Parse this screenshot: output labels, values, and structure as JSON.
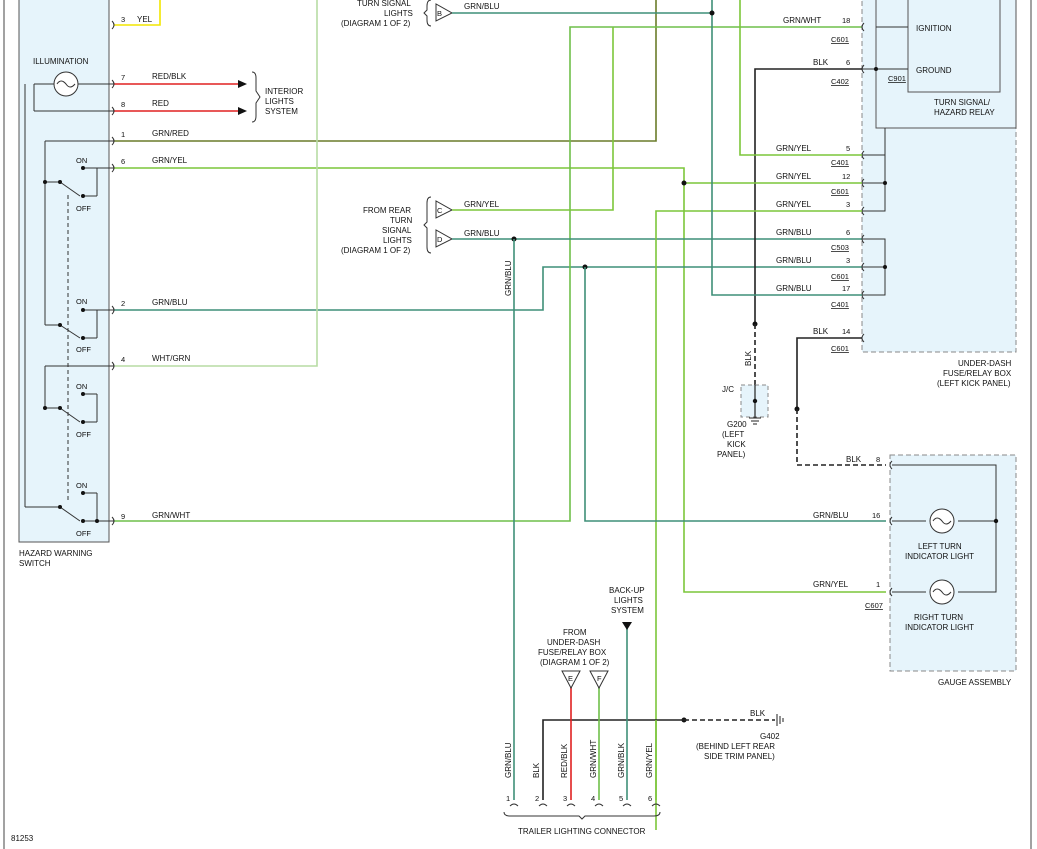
{
  "colors": {
    "grn_blu": "#3f8f78",
    "grn_yel": "#7cc63a",
    "grn_wht": "#6fbf4a",
    "grn_red": "#6a7c2a",
    "red": "#e02020",
    "yel": "#f2e600",
    "wht_grn": "#b7dca4",
    "blk": "#222222",
    "box_fill": "#e6f4fb",
    "box_stroke": "#666666"
  },
  "hazard_switch": {
    "title_line1": "HAZARD WARNING",
    "title_line2": "SWITCH",
    "illumination": "ILLUMINATION",
    "pins": [
      {
        "pin": "3",
        "wire": "YEL"
      },
      {
        "pin": "7",
        "wire": "RED/BLK"
      },
      {
        "pin": "8",
        "wire": "RED"
      },
      {
        "pin": "1",
        "wire": "GRN/RED"
      },
      {
        "pin": "6",
        "wire": "GRN/YEL"
      },
      {
        "pin": "2",
        "wire": "GRN/BLU"
      },
      {
        "pin": "4",
        "wire": "WHT/GRN"
      },
      {
        "pin": "9",
        "wire": "GRN/WHT"
      }
    ],
    "switch_on": "ON",
    "switch_off": "OFF"
  },
  "interior_lights": [
    "INTERIOR",
    "LIGHTS",
    "SYSTEM"
  ],
  "front_turn": {
    "lines": [
      "TURN SIGNAL",
      "LIGHTS",
      "(DIAGRAM 1 OF 2)"
    ],
    "conn_b": "B",
    "wire_b": "GRN/BLU"
  },
  "rear_turn": {
    "lines": [
      "FROM REAR",
      "TURN",
      "SIGNAL",
      "LIGHTS",
      "(DIAGRAM 1 OF 2)"
    ],
    "conn_c": "C",
    "conn_d": "D",
    "wire_c": "GRN/YEL",
    "wire_d": "GRN/BLU"
  },
  "relay": {
    "ignition": "IGNITION",
    "ground": "GROUND",
    "c901": "C901",
    "title_line1": "TURN SIGNAL/",
    "title_line2": "HAZARD RELAY"
  },
  "fuse_box": {
    "title_line1": "UNDER-DASH",
    "title_line2": "FUSE/RELAY BOX",
    "title_line3": "(LEFT KICK PANEL)",
    "rows": [
      {
        "wire": "GRN/WHT",
        "pin": "18",
        "conn": "C601"
      },
      {
        "wire": "BLK",
        "pin": "6",
        "conn": "C402"
      },
      {
        "wire": "GRN/YEL",
        "pin": "5",
        "conn": "C401"
      },
      {
        "wire": "GRN/YEL",
        "pin": "12",
        "conn": "C601"
      },
      {
        "wire": "GRN/YEL",
        "pin": "3",
        "conn": ""
      },
      {
        "wire": "GRN/BLU",
        "pin": "6",
        "conn": "C503"
      },
      {
        "wire": "GRN/BLU",
        "pin": "3",
        "conn": "C601"
      },
      {
        "wire": "GRN/BLU",
        "pin": "17",
        "conn": "C401"
      },
      {
        "wire": "BLK",
        "pin": "14",
        "conn": "C601"
      }
    ]
  },
  "ground_g200": {
    "wire": "BLK",
    "jc": "J/C",
    "lines": [
      "G200",
      "(LEFT",
      "KICK",
      "PANEL)"
    ]
  },
  "gauge": {
    "title": "GAUGE ASSEMBLY",
    "rows": [
      {
        "wire": "BLK",
        "pin": "8"
      },
      {
        "wire": "GRN/BLU",
        "pin": "16"
      },
      {
        "wire": "GRN/YEL",
        "pin": "1"
      }
    ],
    "conn": "C607",
    "left_line1": "LEFT TURN",
    "left_line2": "INDICATOR LIGHT",
    "right_line1": "RIGHT TURN",
    "right_line2": "INDICATOR LIGHT"
  },
  "backup": [
    "BACK-UP",
    "LIGHTS",
    "SYSTEM"
  ],
  "from_fuse": {
    "lines": [
      "FROM",
      "UNDER-DASH",
      "FUSE/RELAY BOX",
      "(DIAGRAM 1 OF 2)"
    ],
    "conn_e": "E",
    "conn_f": "F"
  },
  "g402": {
    "wire": "BLK",
    "lines": [
      "G402",
      "(BEHIND LEFT REAR",
      "SIDE TRIM PANEL)"
    ]
  },
  "trailer": {
    "title": "TRAILER LIGHTING CONNECTOR",
    "pins": [
      {
        "pin": "1",
        "wire": "GRN/BLU"
      },
      {
        "pin": "2",
        "wire": "BLK"
      },
      {
        "pin": "3",
        "wire": "RED/BLK"
      },
      {
        "pin": "4",
        "wire": "GRN/WHT"
      },
      {
        "pin": "5",
        "wire": "GRN/BLK"
      },
      {
        "pin": "6",
        "wire": "GRN/YEL"
      }
    ]
  },
  "figure_id": "81253"
}
